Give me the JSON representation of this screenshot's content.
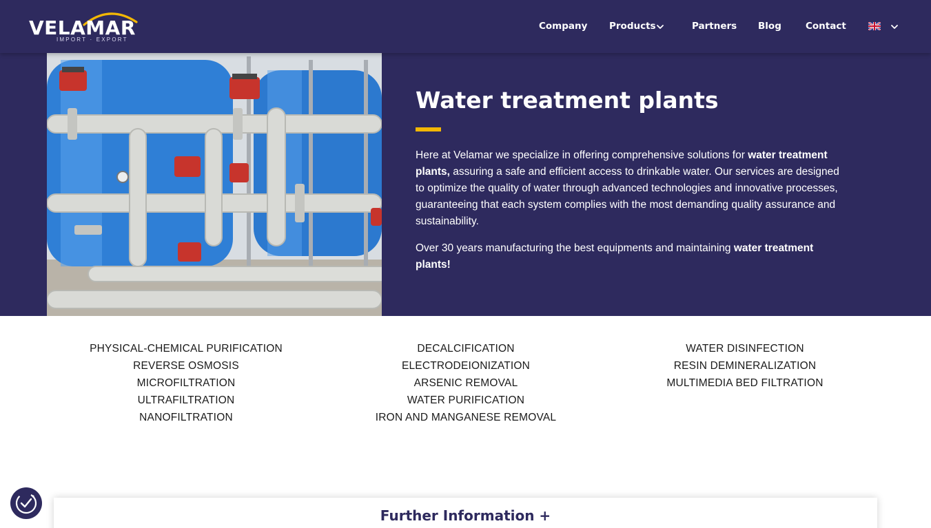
{
  "brand": {
    "name": "VELAMAR",
    "tagline": "IMPORT · EXPORT"
  },
  "nav": {
    "items": [
      {
        "label": "Company"
      },
      {
        "label": "Products"
      },
      {
        "label": "Partners"
      },
      {
        "label": "Blog"
      },
      {
        "label": "Contact"
      }
    ],
    "language_icon": "uk-flag-icon"
  },
  "hero": {
    "title": "Water treatment plants",
    "p1_a": "Here at Velamar we specialize in offering comprehensive solutions for ",
    "p1_b": "water treatment plants,",
    "p1_c": " assuring a safe and efficient access to drinkable water. Our services are designed to optimize the quality of water through advanced technologies and innovative processes, guaranteeing that each system complies with the most demanding quality assurance and sustainability.",
    "p2_a": "Over 30 years manufacturing the best equipments and maintaining ",
    "p2_b": "water treatment plants!",
    "image_alt": "industrial-water-treatment-photo"
  },
  "services": {
    "col1": [
      "PHYSICAL-CHEMICAL PURIFICATION",
      "REVERSE OSMOSIS",
      "MICROFILTRATION",
      "ULTRAFILTRATION",
      "NANOFILTRATION"
    ],
    "col2": [
      "DECALCIFICATION",
      "ELECTRODEIONIZATION",
      "ARSENIC REMOVAL",
      "WATER PURIFICATION",
      "IRON AND MANGANESE REMOVAL"
    ],
    "col3": [
      "WATER DISINFECTION",
      "RESIN DEMINERALIZATION",
      "MULTIMEDIA BED FILTRATION"
    ]
  },
  "further": {
    "label": "Further Information +"
  },
  "colors": {
    "brand_navy": "#2e2a5e",
    "accent_yellow": "#f2b705"
  },
  "icons": {
    "cookie": "cookie-consent-icon",
    "chevron": "chevron-down-icon"
  }
}
